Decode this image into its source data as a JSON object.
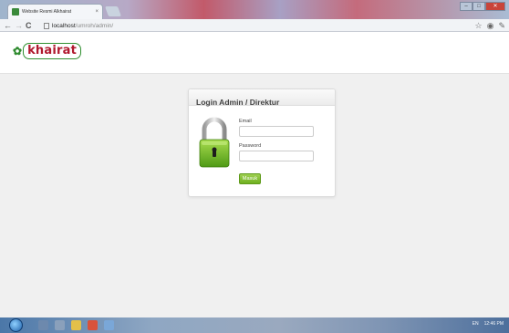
{
  "browser": {
    "tab_title": "Website Resmi Alkhairat",
    "tab_close": "×",
    "url_host": "localhost",
    "url_path": "/umroh/admin/",
    "back": "←",
    "forward": "→",
    "reload": "C",
    "star": "☆"
  },
  "site": {
    "logo_text": "khairat"
  },
  "login": {
    "title": "Login Admin / Direktur",
    "email_label": "Email",
    "email_value": "",
    "password_label": "Password",
    "password_value": "",
    "submit_label": "Masuk"
  },
  "taskbar": {
    "lang": "EN",
    "time": "12:46 PM"
  },
  "colors": {
    "brand_red": "#b0192e",
    "brand_green": "#2f8f2f",
    "button_green": "#7fbf2a",
    "lock_green": "#7cbf2d"
  }
}
